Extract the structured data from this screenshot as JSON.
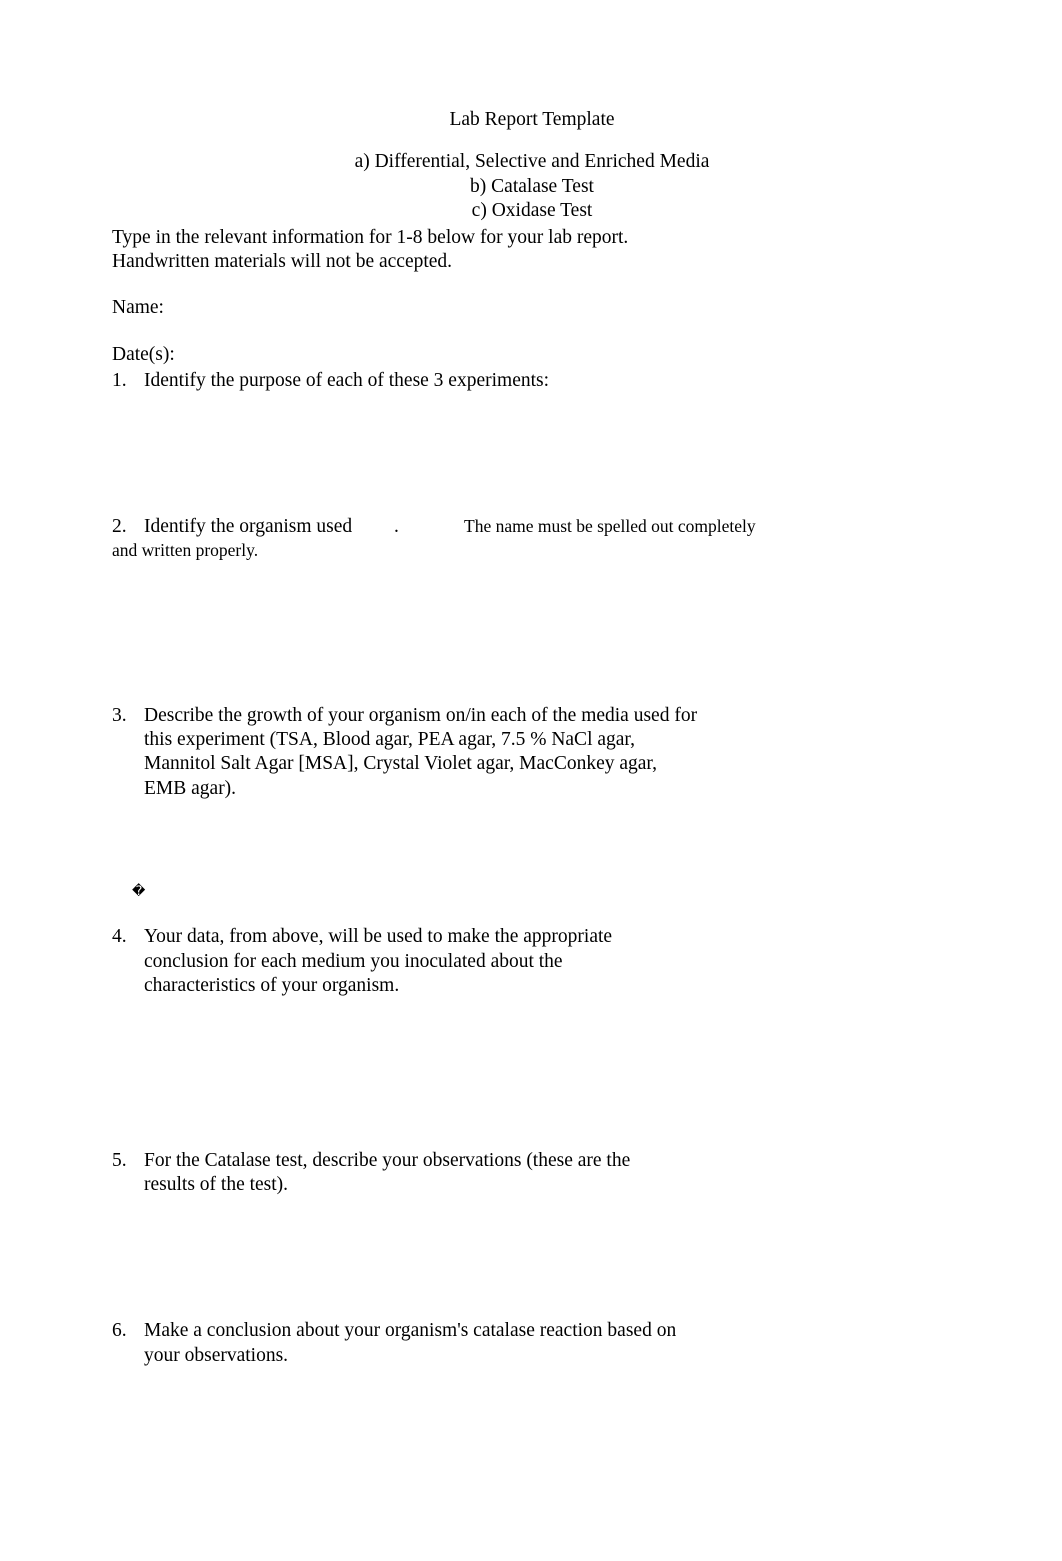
{
  "title": "Lab Report Template",
  "subtitles": {
    "a": "a) Differential, Selective and Enriched Media",
    "b": "b) Catalase Test",
    "c": "c) Oxidase Test"
  },
  "instructions": {
    "line1": "Type in the relevant information for 1-8 below for your lab report.",
    "line2": "Handwritten materials will not be accepted."
  },
  "labels": {
    "name": "Name:",
    "dates": "Date(s):"
  },
  "questions": {
    "q1": {
      "num": "1.",
      "text": "Identify the purpose of each of these 3 experiments:"
    },
    "q2": {
      "num": "2.",
      "lead": "Identify the organism used",
      "dot": ".",
      "tail": "The name must be spelled out completely",
      "cont": "and written properly."
    },
    "q3": {
      "num": "3.",
      "text": "Describe the growth of your organism on/in each of the media used for this experiment (TSA, Blood agar, PEA agar, 7.5 % NaCl agar, Mannitol Salt Agar [MSA], Crystal Violet agar, MacConkey agar, EMB agar)."
    },
    "q4": {
      "num": "4.",
      "text": "Your data, from above, will be used to make the appropriate conclusion for each medium you inoculated about the characteristics of your organism."
    },
    "q5": {
      "num": "5.",
      "text": "For the Catalase test, describe your observations (these are the results of the test)."
    },
    "q6": {
      "num": "6.",
      "text": "Make a conclusion about your organism's catalase reaction based on your observations."
    }
  },
  "bullet_char": "�"
}
